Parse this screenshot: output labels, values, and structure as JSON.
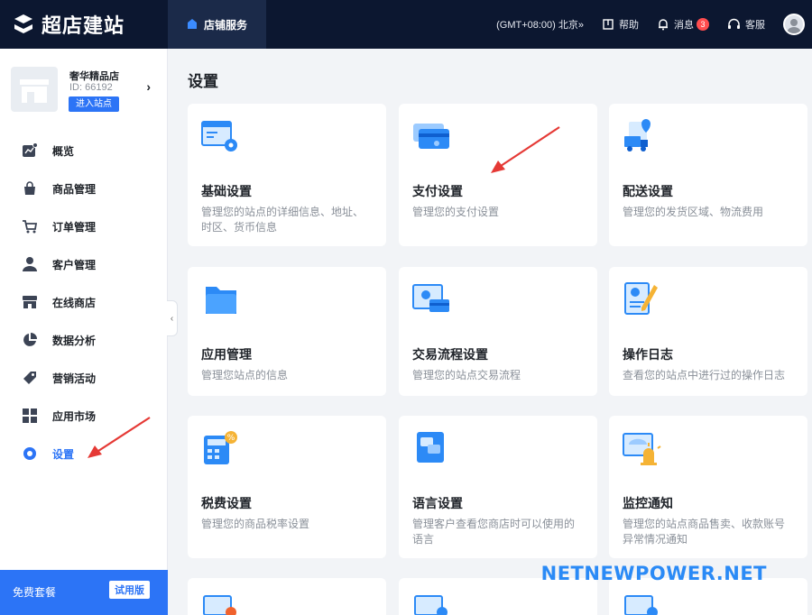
{
  "header": {
    "brand": "超店建站",
    "active_tab": "店铺服务",
    "timezone": "(GMT+08:00) 北京»",
    "help": "帮助",
    "messages": "消息",
    "message_count": "3",
    "service": "客服"
  },
  "store": {
    "name": "奢华精品店",
    "id": "ID: 66192",
    "enter_btn": "进入站点"
  },
  "sidebar": {
    "items": [
      {
        "label": "概览",
        "icon": "overview-icon"
      },
      {
        "label": "商品管理",
        "icon": "bag-icon"
      },
      {
        "label": "订单管理",
        "icon": "cart-icon"
      },
      {
        "label": "客户管理",
        "icon": "user-icon"
      },
      {
        "label": "在线商店",
        "icon": "store-icon"
      },
      {
        "label": "数据分析",
        "icon": "pie-chart-icon"
      },
      {
        "label": "营销活动",
        "icon": "tag-icon"
      },
      {
        "label": "应用市场",
        "icon": "grid-icon"
      },
      {
        "label": "设置",
        "icon": "settings-icon"
      }
    ],
    "active": "设置",
    "plan_label": "免费套餐",
    "plan_badge": "试用版"
  },
  "main": {
    "title": "设置",
    "cards": [
      {
        "title": "基础设置",
        "desc": "管理您的站点的详细信息、地址、时区、货币信息"
      },
      {
        "title": "支付设置",
        "desc": "管理您的支付设置"
      },
      {
        "title": "配送设置",
        "desc": "管理您的发货区域、物流费用"
      },
      {
        "title": "应用管理",
        "desc": "管理您站点的信息"
      },
      {
        "title": "交易流程设置",
        "desc": "管理您的站点交易流程"
      },
      {
        "title": "操作日志",
        "desc": "查看您的站点中进行过的操作日志"
      },
      {
        "title": "税费设置",
        "desc": "管理您的商品税率设置"
      },
      {
        "title": "语言设置",
        "desc": "管理客户查看您商店时可以使用的语言"
      },
      {
        "title": "监控通知",
        "desc": "管理您的站点商品售卖、收款账号异常情况通知"
      }
    ]
  },
  "watermark": "NETNEWPOWER.NET",
  "colors": {
    "accent": "#2c74f6",
    "topbar": "#0c1730",
    "arrow": "#e53935"
  }
}
